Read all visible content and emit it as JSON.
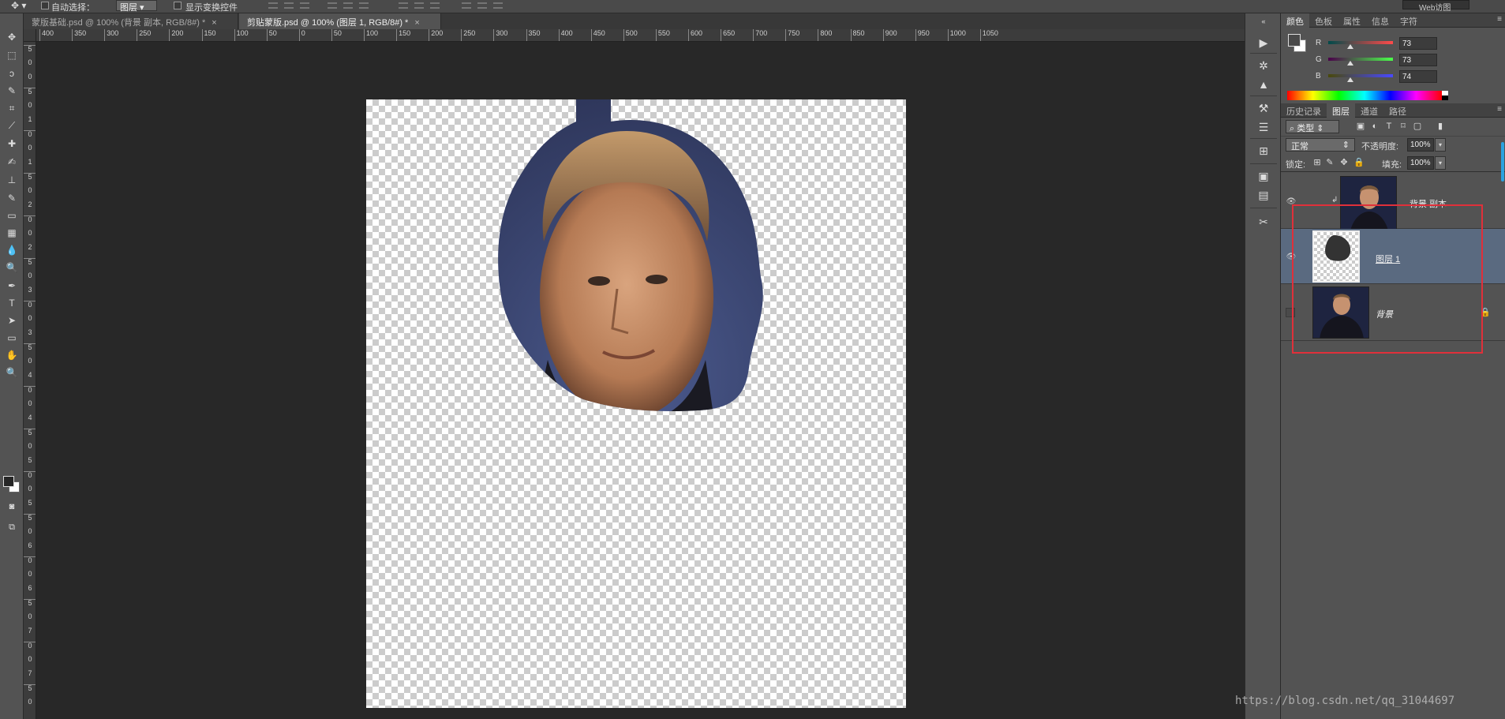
{
  "options_bar": {
    "auto_select_label": "自动选择：",
    "auto_select_target": "图层",
    "show_transform_label": "显示变换控件",
    "workspace": "Web访图"
  },
  "tabs": [
    {
      "label": "蒙版基础.psd @ 100% (背景 副本, RGB/8#) *",
      "close": "×",
      "active": false
    },
    {
      "label": "剪贴蒙版.psd @ 100% (图层 1, RGB/8#) *",
      "close": "×",
      "active": true
    }
  ],
  "ruler_h": [
    "400",
    "350",
    "300",
    "250",
    "200",
    "150",
    "100",
    "50",
    "0",
    "50",
    "100",
    "150",
    "200",
    "250",
    "300",
    "350",
    "400",
    "450",
    "500",
    "550",
    "600",
    "650",
    "700",
    "750",
    "800",
    "850",
    "900",
    "950",
    "1000",
    "1050"
  ],
  "ruler_v": [
    "5",
    "0",
    "0",
    "5",
    "0",
    "1",
    "0",
    "0",
    "1",
    "5",
    "0",
    "2",
    "0",
    "0",
    "2",
    "5",
    "0",
    "3",
    "0",
    "0",
    "3",
    "5",
    "0",
    "4",
    "0",
    "0",
    "4",
    "5",
    "0",
    "5",
    "0",
    "0",
    "5",
    "5",
    "0",
    "6",
    "0",
    "0",
    "6",
    "5",
    "0",
    "7",
    "0",
    "0",
    "7",
    "5",
    "0"
  ],
  "toolbox": {
    "tools": [
      "move-tool-icon",
      "marquee-tool-icon",
      "lasso-tool-icon",
      "quick-select-tool-icon",
      "crop-tool-icon",
      "eyedropper-tool-icon",
      "healing-brush-icon",
      "brush-tool-icon",
      "clone-stamp-icon",
      "history-brush-icon",
      "eraser-tool-icon",
      "gradient-tool-icon",
      "blur-tool-icon",
      "dodge-tool-icon",
      "pen-tool-icon",
      "type-tool-icon",
      "path-select-icon",
      "shape-tool-icon",
      "hand-tool-icon",
      "zoom-tool-icon"
    ],
    "glyphs": [
      "✥",
      "⬚",
      "ↄ",
      "✎",
      "⌗",
      "⟋",
      "✚",
      "✍",
      "⊥",
      "✎",
      "▭",
      "▦",
      "💧",
      "🔍",
      "✒",
      "T",
      "➤",
      "▭",
      "✋",
      "🔍"
    ]
  },
  "color_panel": {
    "tabs": [
      "颜色",
      "色板",
      "属性",
      "信息",
      "字符"
    ],
    "channels": [
      {
        "name": "R",
        "value": "73",
        "gradient": "linear-gradient(90deg,#004a4a,#ff4a4a)"
      },
      {
        "name": "G",
        "value": "73",
        "gradient": "linear-gradient(90deg,#4a004a,#4aff4a)"
      },
      {
        "name": "B",
        "value": "74",
        "gradient": "linear-gradient(90deg,#49490a,#4949ff)"
      }
    ],
    "foreground_color": "#494949",
    "background_color": "#ffffff"
  },
  "layers_panel": {
    "tabs": [
      "历史记录",
      "图层",
      "通道",
      "路径"
    ],
    "kind_filter": "类型",
    "blend_mode": "正常",
    "opacity_label": "不透明度:",
    "opacity_value": "100%",
    "lock_label": "锁定:",
    "fill_label": "填充:",
    "fill_value": "100%",
    "layers": [
      {
        "name": "背景 副本",
        "visible": true,
        "clipped": true,
        "selected": false
      },
      {
        "name": "图层 1",
        "visible": true,
        "clipped": false,
        "selected": true
      },
      {
        "name": "背景",
        "visible": false,
        "locked": true,
        "selected": false
      }
    ]
  },
  "watermark": "https://blog.csdn.net/qq_31044697",
  "colors": {
    "highlight_box": "#e0303a",
    "selection": "#5a6a80",
    "accent_scroll": "#2aa2e0"
  }
}
